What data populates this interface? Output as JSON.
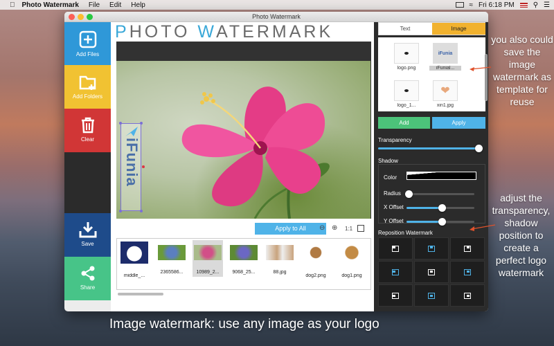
{
  "menubar": {
    "apple_icon": "apple-icon",
    "app_name": "Photo Watermark",
    "menus": [
      "File",
      "Edit",
      "Help"
    ],
    "clock": "Fri 6:18 PM"
  },
  "window": {
    "title": "Photo Watermark",
    "logo_title_parts": [
      "P",
      "HOTO ",
      "W",
      "ATERMARK"
    ]
  },
  "sidebar": {
    "add_files": "Add Files",
    "add_folders": "Add Folders",
    "clear": "Clear",
    "save": "Save",
    "share": "Share",
    "colors": {
      "add_files": "#2f98d8",
      "add_folders": "#f1c232",
      "clear": "#d13636",
      "dark": "#2b2b2b",
      "save": "#1e4b8a",
      "share": "#47c488"
    }
  },
  "preview": {
    "watermark_text": "iFunia"
  },
  "apply_all": "Apply to All",
  "zoom": {
    "out_icon": "zoom-out-icon",
    "in_icon": "zoom-in-icon",
    "actual": "1:1",
    "fit_icon": "fit-screen-icon"
  },
  "thumbnails": [
    {
      "name": "middle_...",
      "color": "#d9d9e6"
    },
    {
      "name": "2365586...",
      "color": "#5b7fc0"
    },
    {
      "name": "10989_2...",
      "color": "#d24f88"
    },
    {
      "name": "9068_25...",
      "color": "#6b67c4"
    },
    {
      "name": "88.jpg",
      "color": "#c9a37d"
    },
    {
      "name": "dog2.png",
      "color": "#b07a43"
    },
    {
      "name": "dog1.png",
      "color": "#c38b45"
    }
  ],
  "right": {
    "tab_text": "Text",
    "tab_image": "Image",
    "images": [
      {
        "name": "logo.png"
      },
      {
        "name": "iFunial...",
        "logo_text": "iFunia"
      },
      {
        "name": "logo_1..."
      },
      {
        "name": "xin1.jpg"
      }
    ],
    "add": "Add",
    "apply": "Apply",
    "transparency_label": "Transparency",
    "transparency_value": 1.0,
    "shadow_label": "Shadow",
    "color_label": "Color",
    "radius_label": "Radius",
    "radius_value": 0.0,
    "xoffset_label": "X Offset",
    "xoffset_value": 0.52,
    "yoffset_label": "Y Offset",
    "yoffset_value": 0.52,
    "reposition_label": "Reposition Watermark",
    "positions": [
      "top-left",
      "top-center",
      "top-right",
      "middle-left",
      "center",
      "middle-right",
      "bottom-left",
      "bottom-center",
      "bottom-right"
    ],
    "active_positions": [
      "top-center",
      "middle-left",
      "middle-right",
      "bottom-center"
    ]
  },
  "annotations": {
    "top_right": "you also could save the image watermark as template for reuse",
    "mid_right": "adjust the transparency, shadow position to create a perfect logo watermark",
    "caption": "Image watermark: use any image as your logo"
  }
}
